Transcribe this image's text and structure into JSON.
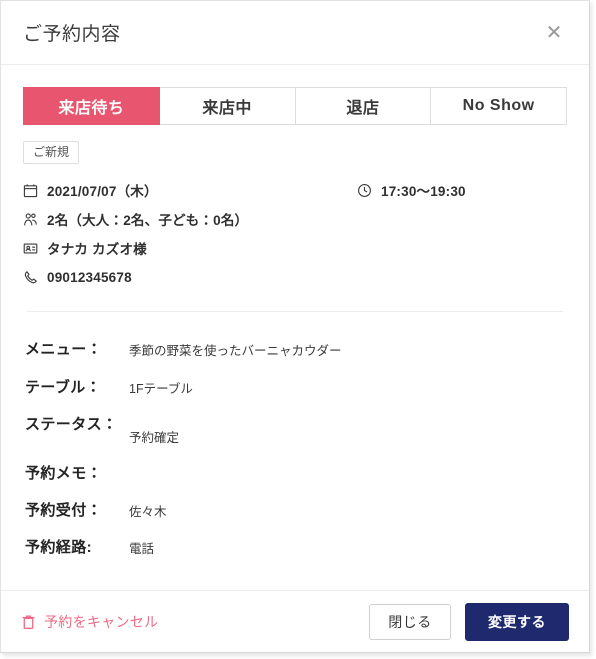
{
  "dialog": {
    "title": "ご予約内容",
    "close_icon": "close-icon"
  },
  "tabs": [
    {
      "label": "来店待ち",
      "active": true
    },
    {
      "label": "来店中",
      "active": false
    },
    {
      "label": "退店",
      "active": false
    },
    {
      "label": "No Show",
      "active": false
    }
  ],
  "badge": {
    "label": "ご新規"
  },
  "summary": {
    "date": "2021/07/07（木）",
    "time": "17:30〜19:30",
    "party": "2名（大人：2名、子ども：0名）",
    "customer": "タナカ カズオ様",
    "phone": "09012345678"
  },
  "fields": [
    {
      "label": "メニュー：",
      "value": "季節の野菜を使ったバーニャカウダー"
    },
    {
      "label": "テーブル：",
      "value": "1Fテーブル"
    },
    {
      "label": "ステータス：",
      "value": "予約確定"
    },
    {
      "label": "予約メモ：",
      "value": ""
    },
    {
      "label": "予約受付：",
      "value": "佐々木"
    },
    {
      "label": "予約経路:",
      "value": "電話"
    }
  ],
  "footer": {
    "cancel_label": "予約をキャンセル",
    "close_label": "閉じる",
    "submit_label": "変更する"
  },
  "colors": {
    "accent_pink": "#e8556f",
    "cancel_pink": "#ef6b85",
    "primary_navy": "#1f2a6e",
    "border_gray": "#dcdcdc"
  }
}
